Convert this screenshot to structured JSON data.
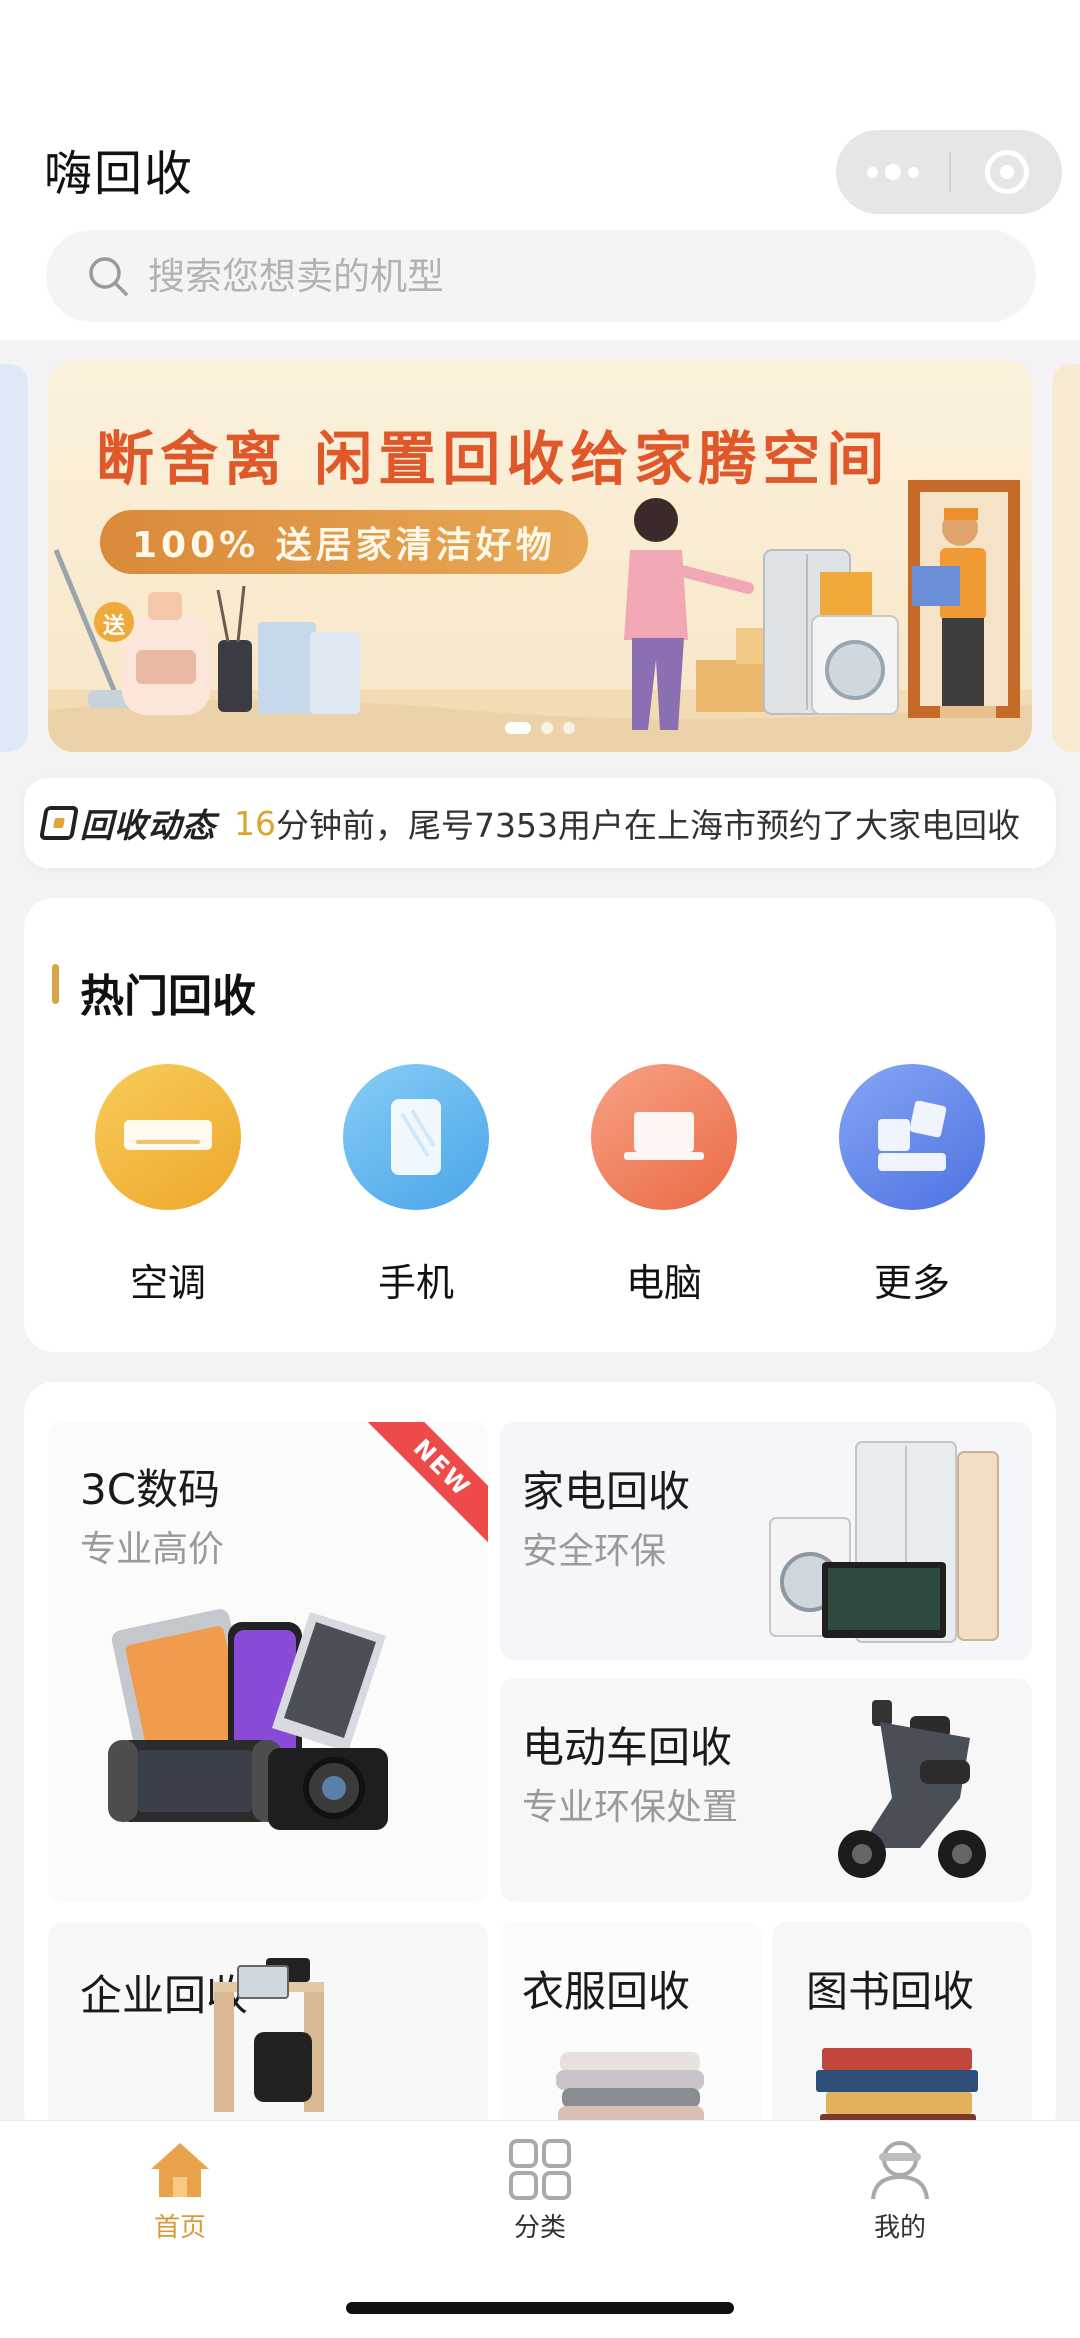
{
  "app": {
    "title": "嗨回收"
  },
  "search": {
    "placeholder": "搜索您想卖的机型"
  },
  "banner": {
    "headline": "断舍离 闲置回收给家腾空间",
    "pill": "100% 送居家清洁好物",
    "gift_tag": "送"
  },
  "ticker": {
    "label": "回收动态",
    "minutes": "16",
    "message": "分钟前，尾号7353用户在上海市预约了大家电回收"
  },
  "hot": {
    "title": "热门回收",
    "items": [
      {
        "label": "空调",
        "icon": "air-conditioner-icon",
        "color": "#f4b73a"
      },
      {
        "label": "手机",
        "icon": "phone-icon",
        "color": "#5fb4ee"
      },
      {
        "label": "电脑",
        "icon": "laptop-icon",
        "color": "#ef7a52"
      },
      {
        "label": "更多",
        "icon": "more-grid-icon",
        "color": "#5d84ea"
      }
    ]
  },
  "categories": {
    "digital": {
      "title": "3C数码",
      "subtitle": "专业高价",
      "badge": "NEW"
    },
    "appliance": {
      "title": "家电回收",
      "subtitle": "安全环保"
    },
    "ebike": {
      "title": "电动车回收",
      "subtitle": "专业环保处置"
    },
    "enterprise": {
      "title": "企业回收"
    },
    "clothes": {
      "title": "衣服回收"
    },
    "books": {
      "title": "图书回收"
    }
  },
  "tabbar": {
    "home": "首页",
    "category": "分类",
    "mine": "我的",
    "active_color": "#d99a3a"
  }
}
